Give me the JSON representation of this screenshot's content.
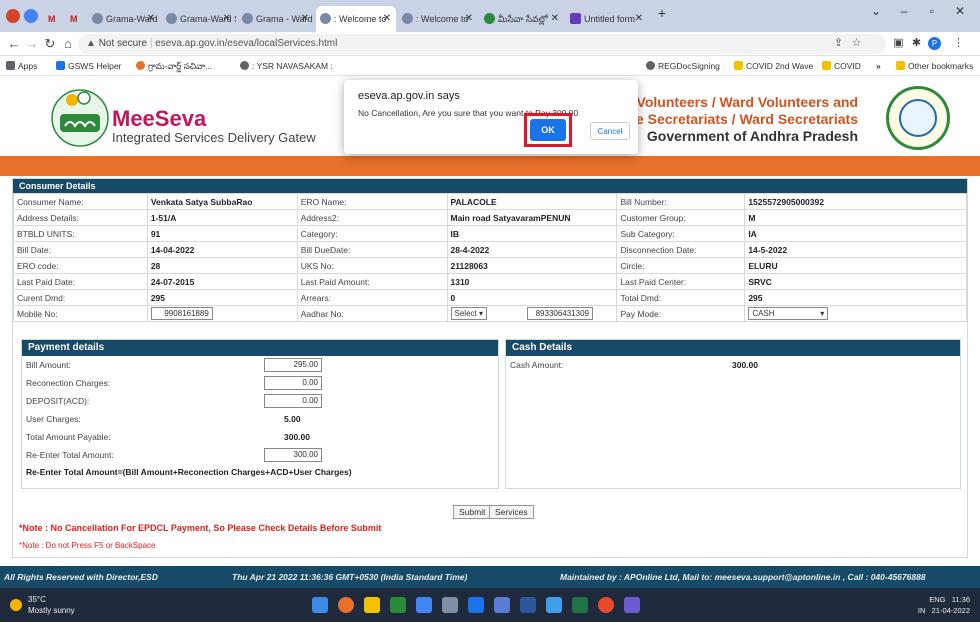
{
  "browser": {
    "tabs": [
      {
        "label": "M",
        "active": false
      },
      {
        "label": "M",
        "active": false
      },
      {
        "label": "Grama-Ward S",
        "active": false
      },
      {
        "label": "Grama-Ward S",
        "active": false
      },
      {
        "label": "Grama - Ward",
        "active": false
      },
      {
        "label": ": Welcome to",
        "active": true
      },
      {
        "label": ": Welcome to",
        "active": false
      },
      {
        "label": "మీసేవా సేవల్లో",
        "active": false
      },
      {
        "label": "Untitled form",
        "active": false
      }
    ],
    "new_tab": "+",
    "url_warning": "Not secure",
    "url": "eseva.ap.gov.in/eseva/localServices.html"
  },
  "bookmarks": [
    {
      "label": "Apps",
      "color": "#5f6368"
    },
    {
      "label": "GSWS Helper",
      "color": "#1a73e8"
    },
    {
      "label": "గ్రామ-వార్డ్ సచివా...",
      "color": "#e8702a"
    },
    {
      "label": ": YSR NAVASAKAM :",
      "color": "#5f6368"
    },
    {
      "label": "REGDocSigning",
      "color": "#5f6368"
    },
    {
      "label": "COVID 2nd Wave",
      "color": "#f2c200"
    },
    {
      "label": "COVID",
      "color": "#f2c200"
    },
    {
      "label": "»",
      "color": ""
    },
    {
      "label": "Other bookmarks",
      "color": "#f2c200"
    }
  ],
  "header": {
    "brand": "MeeSeva",
    "brand_sub": "Integrated Services Delivery Gatew",
    "gov_line1": "ram Volunteers / Ward Volunteers and",
    "gov_line2": "Village Secretariats / Ward Secretariats",
    "gov_line3": "Government of Andhra Pradesh"
  },
  "consumer": {
    "section_title": "Consumer Details",
    "rows": [
      [
        "Consumer Name:",
        "Venkata Satya SubbaRao",
        "ERO Name:",
        "PALACOLE",
        "Bill Number:",
        "1525572905000392"
      ],
      [
        "Address Details:",
        "1-51/A",
        "Address2:",
        "Main road SatyavaramPENUN",
        "Customer Group:",
        "M"
      ],
      [
        "BTBLD UNITS:",
        "91",
        "Category:",
        "IB",
        "Sub Category:",
        "IA"
      ],
      [
        "Bill Date:",
        "14-04-2022",
        "Bill DueDate:",
        "28-4-2022",
        "Disconnection Date:",
        "14-5-2022"
      ],
      [
        "ERO code:",
        "28",
        "UKS No:",
        "21128063",
        "Circle:",
        "ELURU"
      ],
      [
        "Last Paid Date:",
        "24-07-2015",
        "Last Paid Amount:",
        "1310",
        "Last Paid Center:",
        "SRVC"
      ],
      [
        "Curent Dmd:",
        "295",
        "Arrears:",
        "0",
        "Total Dmd:",
        "295"
      ]
    ],
    "mobile_label": "Mobile No:",
    "mobile_value": "9908161889",
    "aadhar_label": "Aadhar No:",
    "aadhar_select": "Select",
    "aadhar_value": "893306431309",
    "paymode_label": "Pay Mode:",
    "paymode_value": "CASH"
  },
  "payment": {
    "title": "Payment details",
    "bill_amount_label": "Bill Amount:",
    "bill_amount": "295.00",
    "reconnection_label": "Reconection Charges:",
    "reconnection": "0.00",
    "deposit_label": "DEPOSIT(ACD):",
    "deposit": "0.00",
    "user_charges_label": "User Charges:",
    "user_charges": "5.00",
    "total_label": "Total Amount Payable:",
    "total": "300.00",
    "reenter_label": "Re-Enter Total Amount:",
    "reenter": "300.00",
    "formula": "Re-Enter Total Amount=(Bill Amount+Reconection Charges+ACD+User Charges)"
  },
  "cash": {
    "title": "Cash Details",
    "amount_label": "Cash Amount:",
    "amount": "300.00"
  },
  "actions": {
    "submit": "Submit",
    "services": "Services"
  },
  "notes": {
    "note1": "*Note : No Cancellation For EPDCL Payment, So Please Check Details Before Submit",
    "note2": "*Note : Do not Press F5 or BackSpace"
  },
  "footer": {
    "rights": "All Rights Reserved with Director,ESD",
    "datetime": "Thu Apr 21 2022 11:36:36 GMT+0530 (India Standard Time)",
    "maintained": "Maintained by : APOnline Ltd, Mail to: meeseva.support@aptonline.in , Call : 040-45676888"
  },
  "taskbar": {
    "temp": "35°C",
    "weather": "Mostly sunny",
    "lang1": "ENG",
    "lang2": "IN",
    "time": "11:36",
    "date": "21-04-2022"
  },
  "dialog": {
    "title": "eseva.ap.gov.in says",
    "message": "No Cancellation, Are you sure that you want to Pay 300.00",
    "ok": "OK",
    "cancel": "Cancel"
  },
  "colors": {
    "header_blue": "#164a67",
    "orange": "#e8702a",
    "ok_blue": "#1a73e8",
    "highlight_red": "#e0162b"
  }
}
